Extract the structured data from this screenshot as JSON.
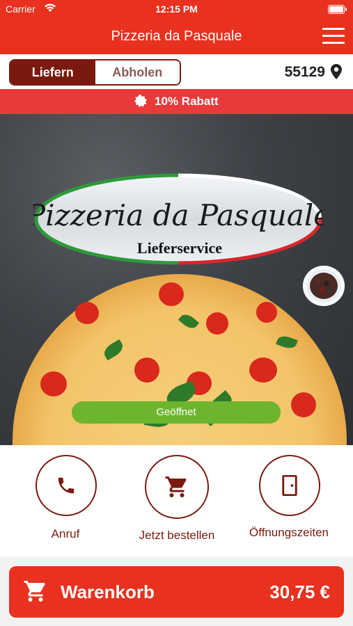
{
  "status_bar": {
    "carrier": "Carrier",
    "time": "12:15 PM"
  },
  "nav": {
    "title": "Pizzeria da Pasquale"
  },
  "mode": {
    "deliver_label": "Liefern",
    "pickup_label": "Abholen",
    "zip": "55129"
  },
  "promo": {
    "text": "10% Rabatt"
  },
  "hero": {
    "logo_script": "Pizzeria da Pasquale",
    "logo_sub": "Lieferservice",
    "status_button": "Geöffnet"
  },
  "actions": [
    {
      "label": "Anruf",
      "icon": "phone-icon"
    },
    {
      "label": "Jetzt bestellen",
      "icon": "cart-icon"
    },
    {
      "label": "Öffnungszeiten",
      "icon": "door-icon"
    }
  ],
  "cart": {
    "label": "Warenkorb",
    "total": "30,75 €"
  },
  "colors": {
    "brand_red": "#e8311e",
    "dark_red": "#7a1a0e",
    "open_green": "#6cb52d"
  }
}
